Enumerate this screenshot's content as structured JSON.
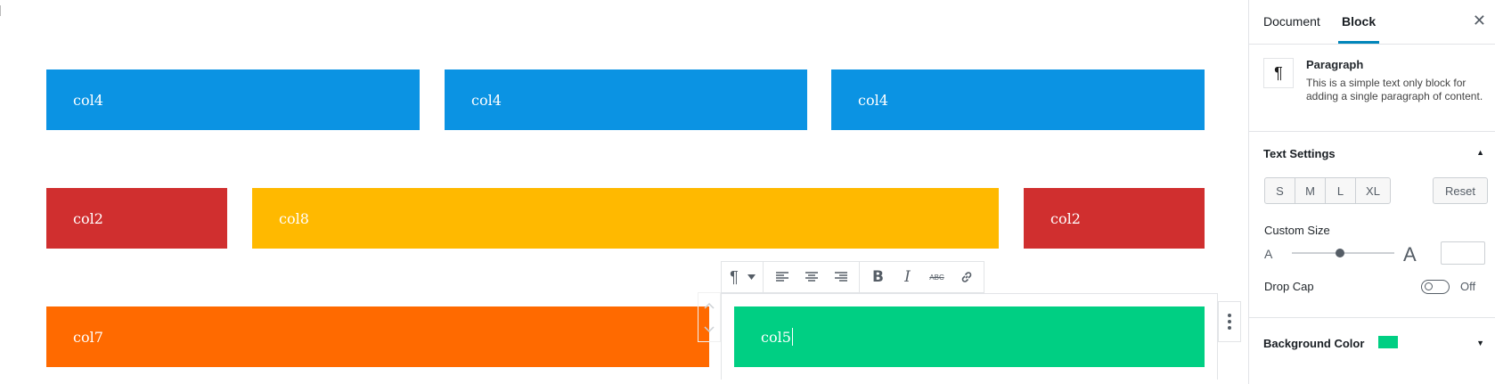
{
  "editor": {
    "rows": [
      [
        {
          "label": "col4",
          "color": "#0b93e3"
        },
        {
          "label": "col4",
          "color": "#0b93e3"
        },
        {
          "label": "col4",
          "color": "#0b93e3"
        }
      ],
      [
        {
          "label": "col2",
          "color": "#d02f2f"
        },
        {
          "label": "col8",
          "color": "#ffb900"
        },
        {
          "label": "col2",
          "color": "#d02f2f"
        }
      ],
      [
        {
          "label": "col7",
          "color": "#ff6a00"
        },
        {
          "label": "col5",
          "color": "#00cf83"
        }
      ]
    ],
    "toolbar": {
      "icons": [
        "paragraph-icon",
        "chevron-down-icon",
        "align-left-icon",
        "align-center-icon",
        "align-right-icon",
        "bold-icon",
        "italic-icon",
        "strikethrough-icon",
        "link-icon"
      ],
      "strikethrough_label": "ABC"
    }
  },
  "sidebar": {
    "tabs": {
      "document": "Document",
      "block": "Block",
      "active": "Block"
    },
    "block": {
      "icon": "paragraph-icon",
      "title": "Paragraph",
      "description": "This is a simple text only block for adding a single paragraph of content."
    },
    "text_settings": {
      "title": "Text Settings",
      "sizes": [
        "S",
        "M",
        "L",
        "XL"
      ],
      "reset": "Reset",
      "custom_size_label": "Custom Size",
      "small_a": "A",
      "large_a": "A",
      "custom_size_value": "",
      "slider_level": 0.47,
      "drop_cap_label": "Drop Cap",
      "drop_cap_state": "Off"
    },
    "background": {
      "title": "Background Color",
      "color": "#00cf83"
    },
    "accent_color": "#0085ba"
  }
}
